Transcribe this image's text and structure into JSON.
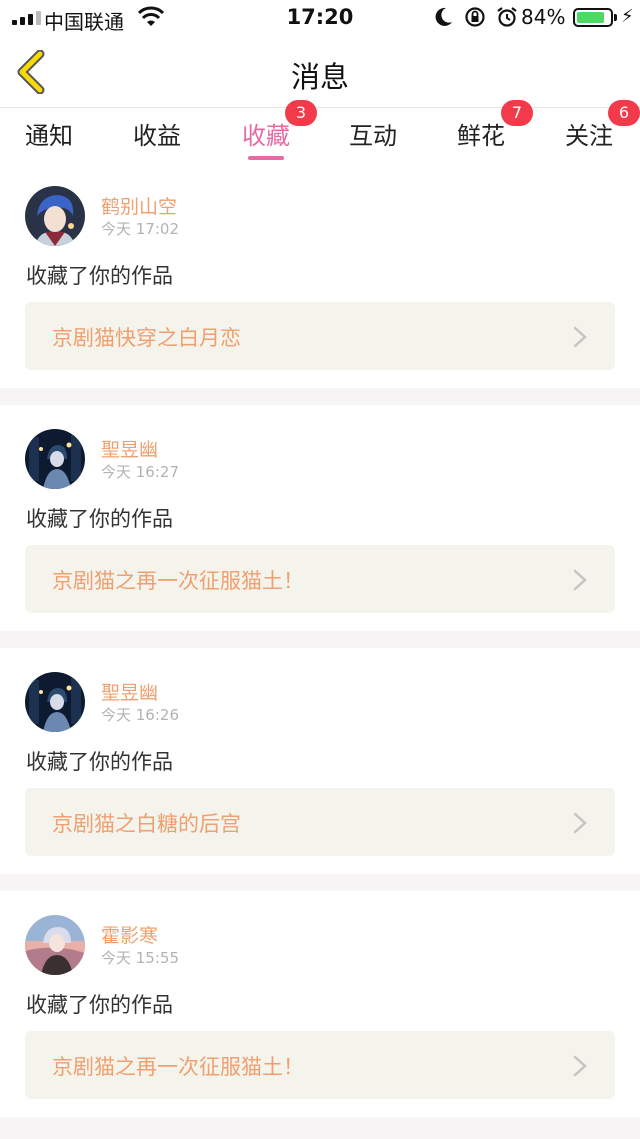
{
  "status_bar": {
    "carrier": "中国联通",
    "time": "17:20",
    "battery_percent": "84%",
    "battery_level": 0.84,
    "icons": [
      "moon-icon",
      "rotation-lock-icon",
      "alarm-icon"
    ]
  },
  "header": {
    "title": "消息"
  },
  "tabs": [
    {
      "label": "通知",
      "badge": "",
      "active": false
    },
    {
      "label": "收益",
      "badge": "",
      "active": false
    },
    {
      "label": "收藏",
      "badge": "3",
      "active": true
    },
    {
      "label": "互动",
      "badge": "",
      "active": false
    },
    {
      "label": "鲜花",
      "badge": "7",
      "active": false
    },
    {
      "label": "关注",
      "badge": "6",
      "active": false
    }
  ],
  "messages": [
    {
      "username": "鹤别山空",
      "time": "今天 17:02",
      "action": "收藏了你的作品",
      "work": "京剧猫快穿之白月恋"
    },
    {
      "username": "聖昱幽",
      "time": "今天 16:27",
      "action": "收藏了你的作品",
      "work": "京剧猫之再一次征服猫土！"
    },
    {
      "username": "聖昱幽",
      "time": "今天 16:26",
      "action": "收藏了你的作品",
      "work": "京剧猫之白糖的后宫"
    },
    {
      "username": "霍影寒",
      "time": "今天 15:55",
      "action": "收藏了你的作品",
      "work": "京剧猫之再一次征服猫土！"
    }
  ],
  "colors": {
    "accent_pink": "#e86aa4",
    "badge_red": "#f23a4a",
    "name_orange": "#f0a070",
    "back_arrow": "#f5d90a",
    "battery_green": "#4cd964"
  }
}
